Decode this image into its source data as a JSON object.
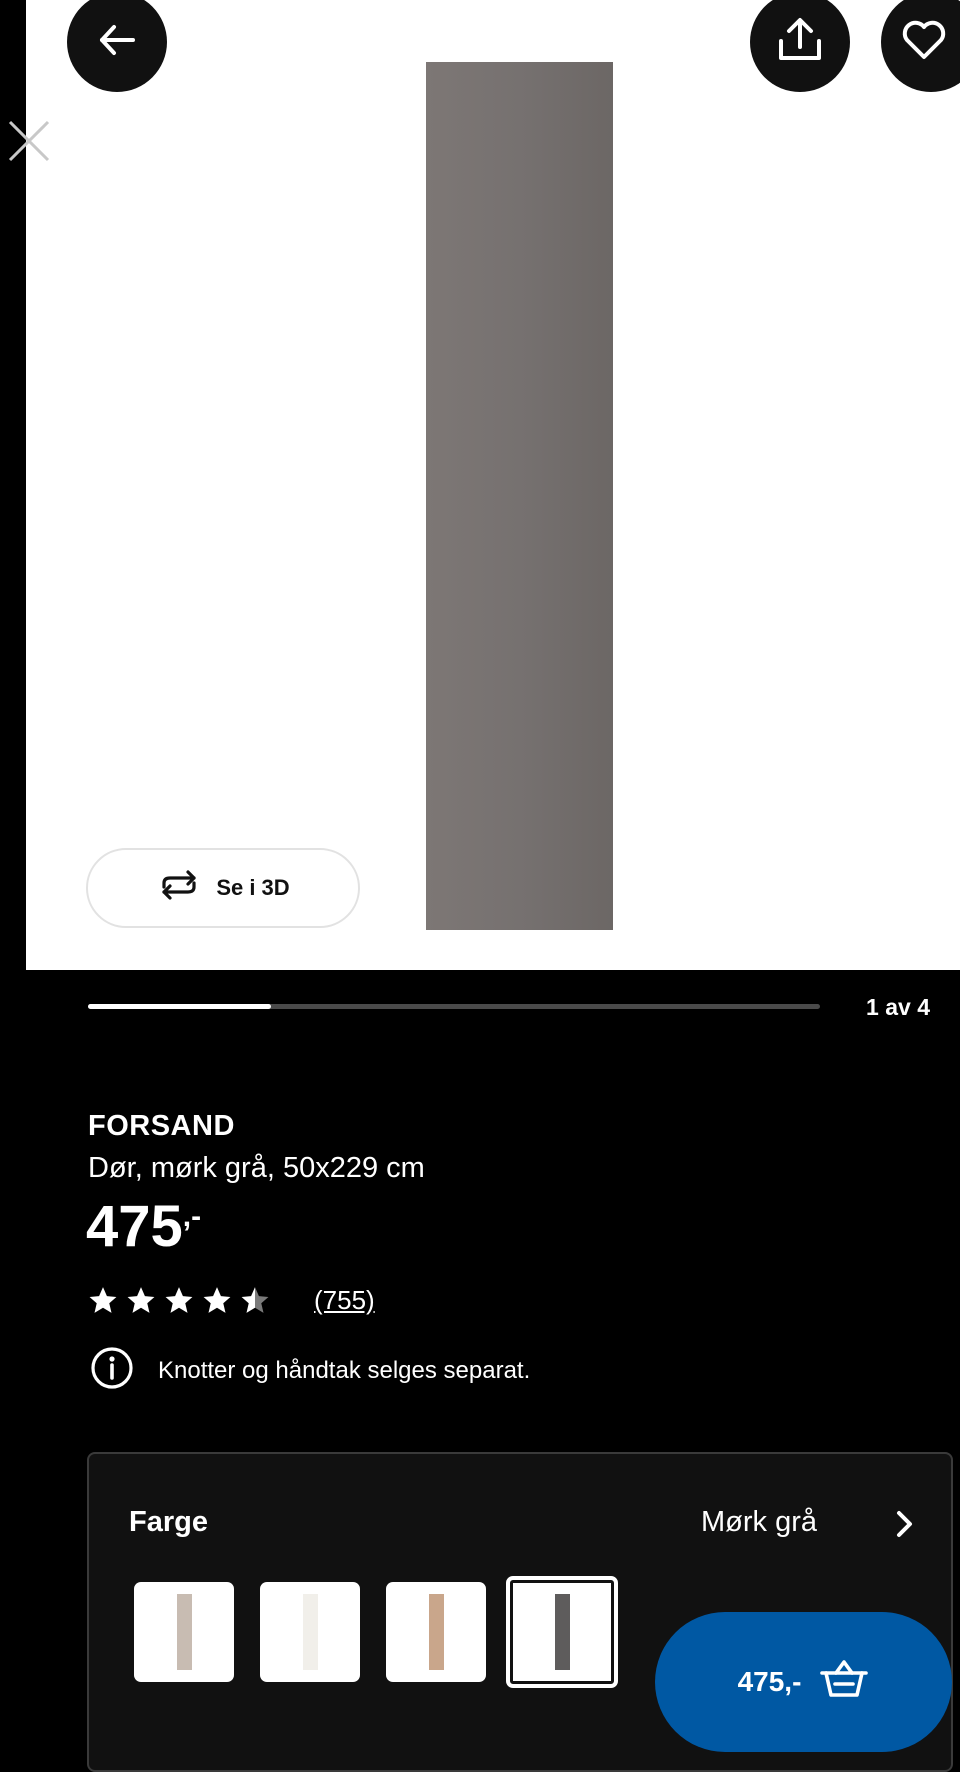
{
  "gallery": {
    "view_3d_label": "Se i 3D",
    "page_indicator": "1 av 4",
    "progress_fraction": 0.25
  },
  "product": {
    "name": "FORSAND",
    "description": "Dør, mørk grå, 50x229 cm",
    "price": "475",
    "price_suffix": ",-",
    "rating": 4.5,
    "review_count": "(755)",
    "info_note": "Knotter og håndtak selges separat."
  },
  "variant": {
    "label": "Farge",
    "selected_value": "Mørk grå",
    "swatches": [
      {
        "color": "#c8bcb2"
      },
      {
        "color": "#f1efea"
      },
      {
        "color": "#c9a68b"
      },
      {
        "color": "#5e5c5c"
      }
    ]
  },
  "cart": {
    "price_label": "475,-"
  },
  "colors": {
    "accent": "#0058a3",
    "background": "#111111",
    "door": "#767170"
  },
  "icons": [
    "back-arrow-icon",
    "share-icon",
    "heart-icon",
    "close-icon",
    "rotate-3d-icon",
    "star-icon",
    "info-icon",
    "chevron-right-icon",
    "basket-icon"
  ]
}
